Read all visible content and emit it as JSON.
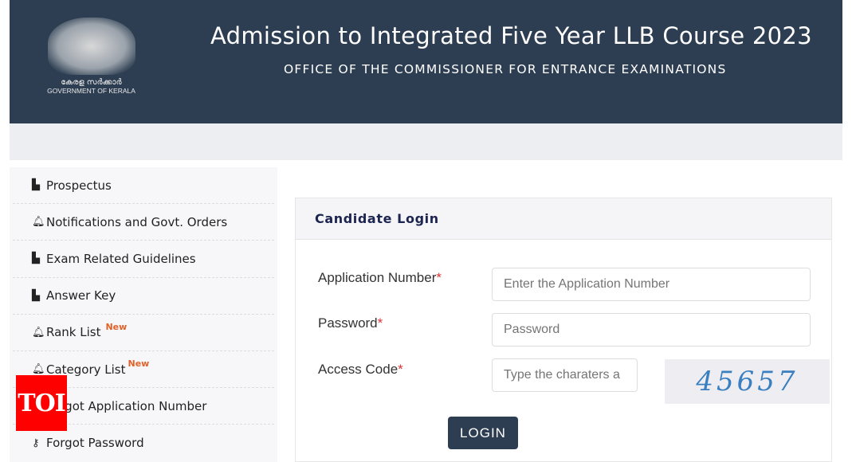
{
  "header": {
    "title": "Admission to Integrated Five Year LLB Course 2023",
    "subtitle": "OFFICE OF THE COMMISSIONER FOR ENTRANCE EXAMINATIONS",
    "logo_text_ml": "കേരള സർക്കാർ",
    "logo_text_en": "GOVERNMENT OF KERALA"
  },
  "sidebar": {
    "items": [
      {
        "label": "Prospectus",
        "icon": "pdf-icon"
      },
      {
        "label": "Notifications and Govt. Orders",
        "icon": "bell-icon"
      },
      {
        "label": "Exam Related Guidelines",
        "icon": "pdf-icon"
      },
      {
        "label": "Answer Key",
        "icon": "pdf-icon"
      },
      {
        "label": "Rank List",
        "icon": "bell-icon",
        "badge": "New"
      },
      {
        "label": "Category List",
        "icon": "bell-icon",
        "badge": "New"
      },
      {
        "label": "Forgot Application Number",
        "icon": "bell-icon"
      },
      {
        "label": "Forgot Password",
        "icon": "key-icon"
      }
    ]
  },
  "watermark": "TOI",
  "login": {
    "title": "Candidate Login",
    "app_label": "Application Number",
    "app_placeholder": "Enter the Application Number",
    "pw_label": "Password",
    "pw_placeholder": "Password",
    "code_label": "Access Code",
    "code_placeholder": "Type the charaters a",
    "captcha": "45657",
    "required_mark": "*",
    "button": "LOGIN"
  }
}
